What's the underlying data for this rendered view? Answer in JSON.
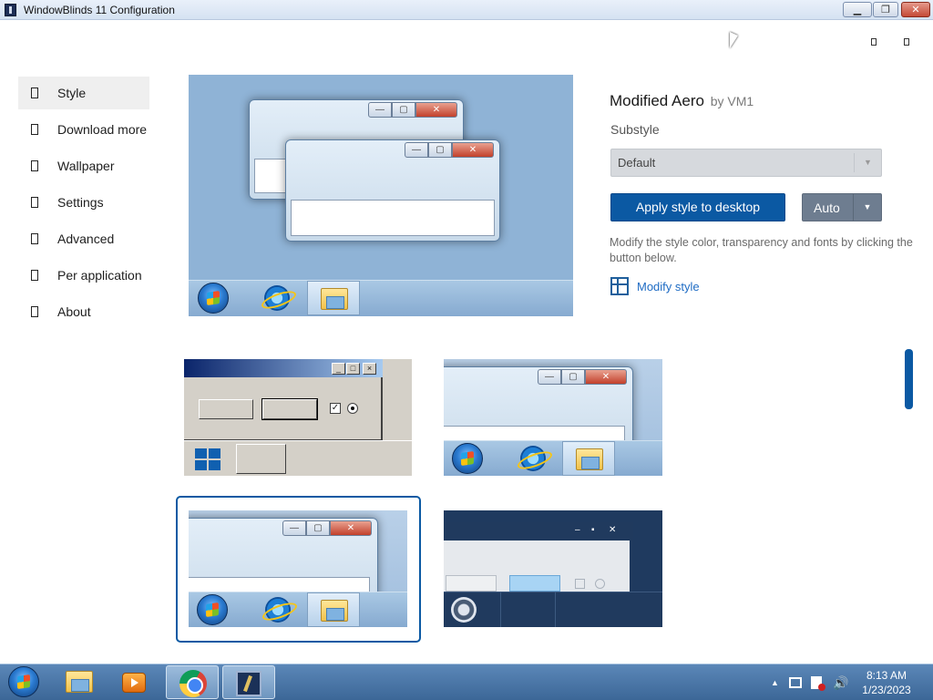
{
  "window": {
    "title": "WindowBlinds 11 Configuration",
    "minimize": "▁",
    "maximize": "❐",
    "close": "✕"
  },
  "nav": {
    "items": [
      {
        "label": "Style",
        "active": true
      },
      {
        "label": "Download more"
      },
      {
        "label": "Wallpaper"
      },
      {
        "label": "Settings"
      },
      {
        "label": "Advanced"
      },
      {
        "label": "Per application"
      },
      {
        "label": "About"
      }
    ]
  },
  "style": {
    "name": "Modified Aero",
    "author": "by VM1",
    "substyle_label": "Substyle",
    "substyle_value": "Default",
    "apply_label": "Apply style to desktop",
    "auto_label": "Auto",
    "modify_description": "Modify the style color, transparency and fonts by clicking the button below.",
    "modify_link": "Modify style"
  },
  "preview": {
    "min": "—",
    "max": "▢",
    "close": "✕"
  },
  "thumbnails": {
    "classic_check": "✓",
    "dark_max": "▪",
    "dark_close": "✕",
    "selected_index": 2
  },
  "taskbar": {
    "time": "8:13 AM",
    "date": "1/23/2023"
  },
  "colors": {
    "accent": "#0b59a3",
    "auto_button": "#6e7d90",
    "link": "#1f6cc4"
  }
}
